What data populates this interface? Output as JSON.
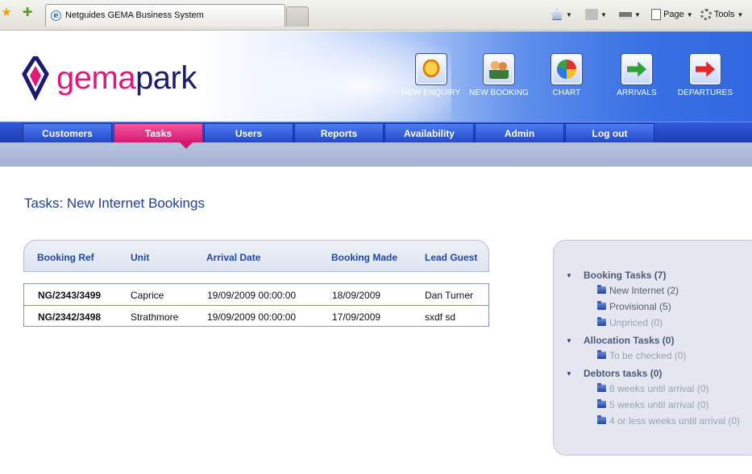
{
  "browser": {
    "tab_title": "Netguides GEMA Business System",
    "page_label": "Page",
    "tools_label": "Tools"
  },
  "logo": {
    "part1": "gema",
    "part2": "park"
  },
  "header_buttons": [
    {
      "label": "NEW ENQUIRY",
      "icon": "speech-bubble-icon"
    },
    {
      "label": "NEW BOOKING",
      "icon": "people-icon"
    },
    {
      "label": "CHART",
      "icon": "chart-icon"
    },
    {
      "label": "ARRIVALS",
      "icon": "arrow-in-icon"
    },
    {
      "label": "DEPARTURES",
      "icon": "arrow-out-icon"
    }
  ],
  "nav": [
    "Customers",
    "Tasks",
    "Users",
    "Reports",
    "Availability",
    "Admin",
    "Log out"
  ],
  "nav_active": "Tasks",
  "page_title": "Tasks: New Internet Bookings",
  "table": {
    "columns": [
      "Booking Ref",
      "Unit",
      "Arrival Date",
      "Booking Made",
      "Lead Guest"
    ],
    "rows": [
      [
        "NG/2343/3499",
        "Caprice",
        "19/09/2009 00:00:00",
        "18/09/2009",
        "Dan Turner"
      ],
      [
        "NG/2342/3498",
        "Strathmore",
        "19/09/2009 00:00:00",
        "17/09/2009",
        "sxdf sd"
      ]
    ]
  },
  "sidebar": {
    "sections": [
      {
        "title": "Booking Tasks (7)",
        "items": [
          "New Internet (2)",
          "Provisional (5)",
          "Unpriced (0)"
        ]
      },
      {
        "title": "Allocation Tasks (0)",
        "items": [
          "To be checked (0)"
        ]
      },
      {
        "title": "Debtors tasks (0)",
        "items": [
          "6 weeks until arrival (0)",
          "5 weeks until arrival (0)",
          "4 or less weeks until arrival (0)"
        ]
      }
    ]
  },
  "colors": {
    "brand_pink": "#e2197a",
    "brand_navy": "#1a1a6e",
    "nav_blue": "#2147c6",
    "active_tab": "#d5176f"
  }
}
